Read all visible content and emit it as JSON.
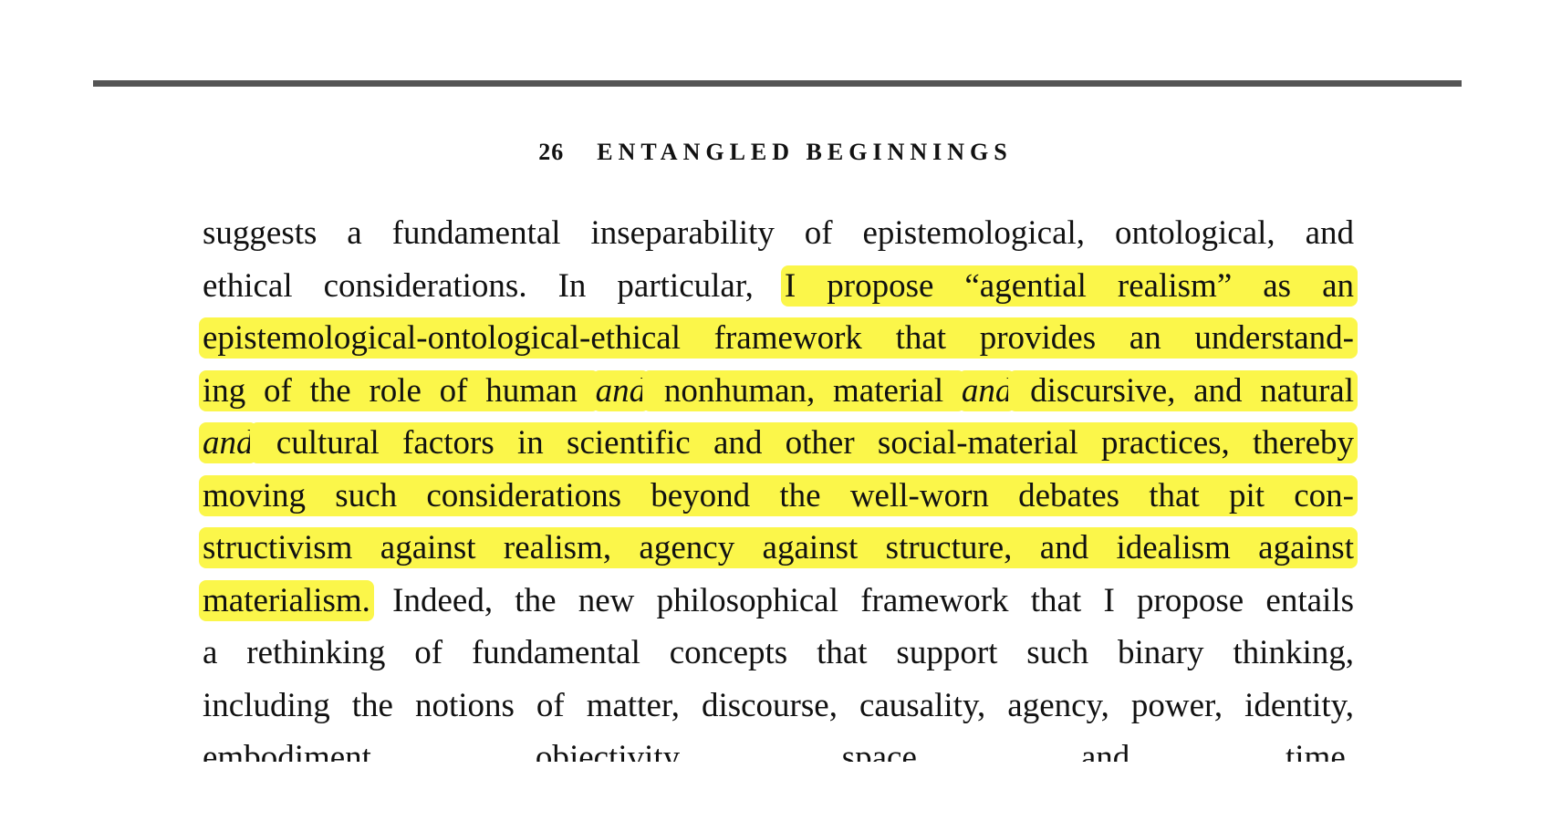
{
  "header": {
    "page_number": "26",
    "running_title": "ENTANGLED BEGINNINGS"
  },
  "colors": {
    "highlight": "#fbf64a",
    "rule": "#555555",
    "text": "#111111"
  },
  "lines": [
    [
      {
        "t": "suggests a fundamental inseparability of epistemological, ontological, and"
      }
    ],
    [
      {
        "t": "ethical considerations. In particular, "
      },
      {
        "t": "I propose “agential realism” as an",
        "hl": true
      }
    ],
    [
      {
        "t": "epistemological-ontological-ethical framework that provides an understand-",
        "hl": true
      }
    ],
    [
      {
        "t": "ing of the role of human ",
        "hl": true
      },
      {
        "t": "and",
        "hl": true,
        "i": true
      },
      {
        "t": " nonhuman, material ",
        "hl": true
      },
      {
        "t": "and",
        "hl": true,
        "i": true
      },
      {
        "t": " discursive, and natural",
        "hl": true
      }
    ],
    [
      {
        "t": "and",
        "hl": true,
        "i": true
      },
      {
        "t": " cultural factors in scientific and other social-material practices, thereby",
        "hl": true
      }
    ],
    [
      {
        "t": "moving such considerations beyond the well-worn debates that pit con-",
        "hl": true
      }
    ],
    [
      {
        "t": "structivism against realism, agency against structure, and idealism against",
        "hl": true
      }
    ],
    [
      {
        "t": "materialism.",
        "hl": true
      },
      {
        "t": " Indeed, the new philosophical framework that I propose entails"
      }
    ],
    [
      {
        "t": "a rethinking of fundamental concepts that support such binary thinking,"
      }
    ],
    [
      {
        "t": "including the notions of matter, discourse, causality, agency, power, identity,"
      }
    ],
    [
      {
        "t": "embodiment, objectivity, space, and time."
      }
    ]
  ]
}
